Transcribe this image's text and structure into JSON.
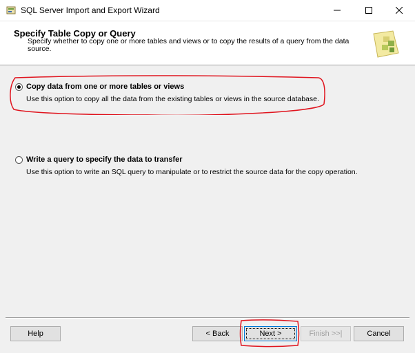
{
  "window": {
    "title": "SQL Server Import and Export Wizard",
    "icon": "wizard-app-icon"
  },
  "header": {
    "title": "Specify Table Copy or Query",
    "description": "Specify whether to copy one or more tables and views or to copy the results of a query from the data source.",
    "icon": "wizard-page-icon"
  },
  "options": [
    {
      "label": "Copy data from one or more tables or views",
      "description": "Use this option to copy all the data from the existing tables or views in the source database.",
      "selected": true
    },
    {
      "label": "Write a query to specify the data to transfer",
      "description": "Use this option to write an SQL query to manipulate or to restrict the source data for the copy operation.",
      "selected": false
    }
  ],
  "buttons": {
    "help": "Help",
    "back": "< Back",
    "next": "Next >",
    "finish": "Finish >>|",
    "cancel": "Cancel"
  },
  "annotation_color": "#e0141e"
}
